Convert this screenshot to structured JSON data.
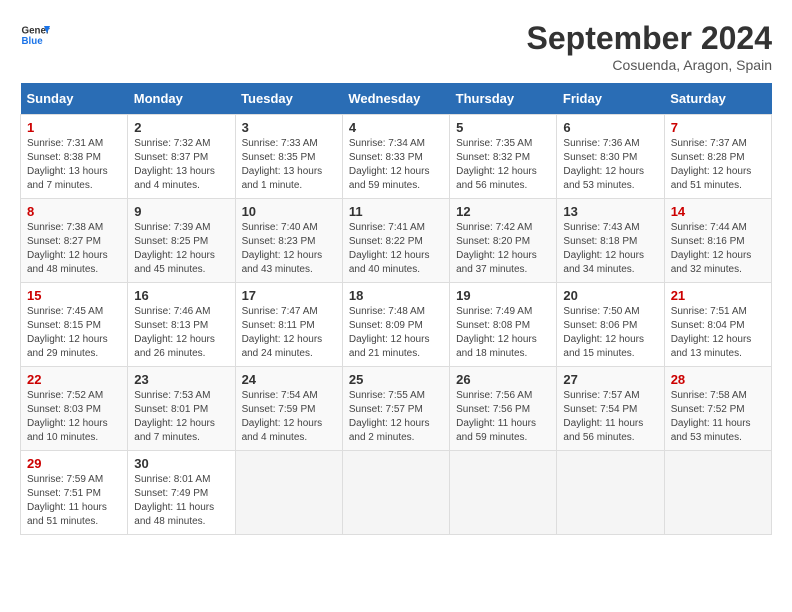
{
  "header": {
    "logo_line1": "General",
    "logo_line2": "Blue",
    "month": "September 2024",
    "location": "Cosuenda, Aragon, Spain"
  },
  "days_of_week": [
    "Sunday",
    "Monday",
    "Tuesday",
    "Wednesday",
    "Thursday",
    "Friday",
    "Saturday"
  ],
  "weeks": [
    [
      {
        "day": "1",
        "info": "Sunrise: 7:31 AM\nSunset: 8:38 PM\nDaylight: 13 hours\nand 7 minutes."
      },
      {
        "day": "2",
        "info": "Sunrise: 7:32 AM\nSunset: 8:37 PM\nDaylight: 13 hours\nand 4 minutes."
      },
      {
        "day": "3",
        "info": "Sunrise: 7:33 AM\nSunset: 8:35 PM\nDaylight: 13 hours\nand 1 minute."
      },
      {
        "day": "4",
        "info": "Sunrise: 7:34 AM\nSunset: 8:33 PM\nDaylight: 12 hours\nand 59 minutes."
      },
      {
        "day": "5",
        "info": "Sunrise: 7:35 AM\nSunset: 8:32 PM\nDaylight: 12 hours\nand 56 minutes."
      },
      {
        "day": "6",
        "info": "Sunrise: 7:36 AM\nSunset: 8:30 PM\nDaylight: 12 hours\nand 53 minutes."
      },
      {
        "day": "7",
        "info": "Sunrise: 7:37 AM\nSunset: 8:28 PM\nDaylight: 12 hours\nand 51 minutes."
      }
    ],
    [
      {
        "day": "8",
        "info": "Sunrise: 7:38 AM\nSunset: 8:27 PM\nDaylight: 12 hours\nand 48 minutes."
      },
      {
        "day": "9",
        "info": "Sunrise: 7:39 AM\nSunset: 8:25 PM\nDaylight: 12 hours\nand 45 minutes."
      },
      {
        "day": "10",
        "info": "Sunrise: 7:40 AM\nSunset: 8:23 PM\nDaylight: 12 hours\nand 43 minutes."
      },
      {
        "day": "11",
        "info": "Sunrise: 7:41 AM\nSunset: 8:22 PM\nDaylight: 12 hours\nand 40 minutes."
      },
      {
        "day": "12",
        "info": "Sunrise: 7:42 AM\nSunset: 8:20 PM\nDaylight: 12 hours\nand 37 minutes."
      },
      {
        "day": "13",
        "info": "Sunrise: 7:43 AM\nSunset: 8:18 PM\nDaylight: 12 hours\nand 34 minutes."
      },
      {
        "day": "14",
        "info": "Sunrise: 7:44 AM\nSunset: 8:16 PM\nDaylight: 12 hours\nand 32 minutes."
      }
    ],
    [
      {
        "day": "15",
        "info": "Sunrise: 7:45 AM\nSunset: 8:15 PM\nDaylight: 12 hours\nand 29 minutes."
      },
      {
        "day": "16",
        "info": "Sunrise: 7:46 AM\nSunset: 8:13 PM\nDaylight: 12 hours\nand 26 minutes."
      },
      {
        "day": "17",
        "info": "Sunrise: 7:47 AM\nSunset: 8:11 PM\nDaylight: 12 hours\nand 24 minutes."
      },
      {
        "day": "18",
        "info": "Sunrise: 7:48 AM\nSunset: 8:09 PM\nDaylight: 12 hours\nand 21 minutes."
      },
      {
        "day": "19",
        "info": "Sunrise: 7:49 AM\nSunset: 8:08 PM\nDaylight: 12 hours\nand 18 minutes."
      },
      {
        "day": "20",
        "info": "Sunrise: 7:50 AM\nSunset: 8:06 PM\nDaylight: 12 hours\nand 15 minutes."
      },
      {
        "day": "21",
        "info": "Sunrise: 7:51 AM\nSunset: 8:04 PM\nDaylight: 12 hours\nand 13 minutes."
      }
    ],
    [
      {
        "day": "22",
        "info": "Sunrise: 7:52 AM\nSunset: 8:03 PM\nDaylight: 12 hours\nand 10 minutes."
      },
      {
        "day": "23",
        "info": "Sunrise: 7:53 AM\nSunset: 8:01 PM\nDaylight: 12 hours\nand 7 minutes."
      },
      {
        "day": "24",
        "info": "Sunrise: 7:54 AM\nSunset: 7:59 PM\nDaylight: 12 hours\nand 4 minutes."
      },
      {
        "day": "25",
        "info": "Sunrise: 7:55 AM\nSunset: 7:57 PM\nDaylight: 12 hours\nand 2 minutes."
      },
      {
        "day": "26",
        "info": "Sunrise: 7:56 AM\nSunset: 7:56 PM\nDaylight: 11 hours\nand 59 minutes."
      },
      {
        "day": "27",
        "info": "Sunrise: 7:57 AM\nSunset: 7:54 PM\nDaylight: 11 hours\nand 56 minutes."
      },
      {
        "day": "28",
        "info": "Sunrise: 7:58 AM\nSunset: 7:52 PM\nDaylight: 11 hours\nand 53 minutes."
      }
    ],
    [
      {
        "day": "29",
        "info": "Sunrise: 7:59 AM\nSunset: 7:51 PM\nDaylight: 11 hours\nand 51 minutes."
      },
      {
        "day": "30",
        "info": "Sunrise: 8:01 AM\nSunset: 7:49 PM\nDaylight: 11 hours\nand 48 minutes."
      },
      {
        "day": "",
        "info": ""
      },
      {
        "day": "",
        "info": ""
      },
      {
        "day": "",
        "info": ""
      },
      {
        "day": "",
        "info": ""
      },
      {
        "day": "",
        "info": ""
      }
    ]
  ]
}
